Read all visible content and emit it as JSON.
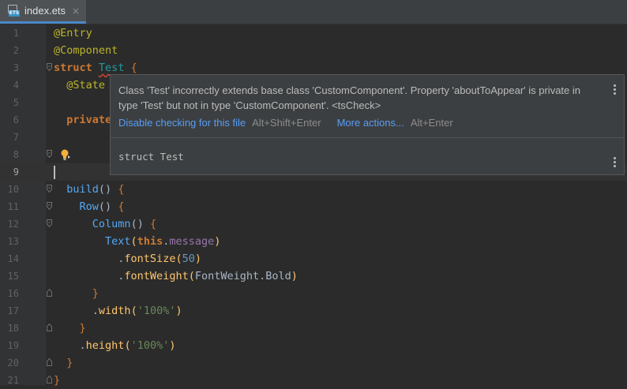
{
  "tab": {
    "icon_badge": "ETS",
    "filename": "index.ets",
    "close_glyph": "×",
    "accent": "#4a88c7"
  },
  "gutter": {
    "line_numbers": [
      "1",
      "2",
      "3",
      "4",
      "5",
      "6",
      "7",
      "8",
      "9",
      "10",
      "11",
      "12",
      "13",
      "14",
      "15",
      "16",
      "17",
      "18",
      "19",
      "20",
      "21"
    ],
    "current_line": 9
  },
  "code": {
    "l1_ann": "@Entry",
    "l2_ann": "@Component",
    "l3_kw": "struct",
    "l3_name": "Test",
    "l3_brace": "{",
    "l4_ann": "@State",
    "l6_kw": "private",
    "l10_fn": "build",
    "l10_parens": "()",
    "l10_brace": "{",
    "l11_comp": "Row",
    "l11_parens": "()",
    "l11_brace": "{",
    "l12_comp": "Column",
    "l12_parens": "()",
    "l12_brace": "{",
    "l13_comp": "Text",
    "l13_open": "(",
    "l13_this": "this",
    "l13_dot": ".",
    "l13_field": "message",
    "l13_close": ")",
    "l14_dot": ".",
    "l14_fn": "fontSize",
    "l14_open": "(",
    "l14_num": "50",
    "l14_close": ")",
    "l15_dot": ".",
    "l15_fn": "fontWeight",
    "l15_open": "(",
    "l15_arg": "FontWeight.Bold",
    "l15_close": ")",
    "l16_brace": "}",
    "l17_dot": ".",
    "l17_fn": "width",
    "l17_open": "(",
    "l17_str": "'100%'",
    "l17_close": ")",
    "l18_brace": "}",
    "l19_dot": ".",
    "l19_fn": "height",
    "l19_open": "(",
    "l19_str": "'100%'",
    "l19_close": ")",
    "l20_brace": "}",
    "l21_brace": "}"
  },
  "popup": {
    "message": "Class 'Test' incorrectly extends base class 'CustomComponent'. Property 'aboutToAppear' is private in type 'Test' but not in type 'CustomComponent'. <tsCheck>",
    "action_disable": "Disable checking for this file",
    "action_disable_shortcut": "Alt+Shift+Enter",
    "action_more": "More actions...",
    "action_more_shortcut": "Alt+Enter",
    "preview": "struct Test"
  },
  "icons": {
    "file": "ets-file-icon",
    "bulb": "quick-fix-bulb-icon",
    "fold": "fold-marker-icon",
    "menu": "more-vertical-icon"
  }
}
